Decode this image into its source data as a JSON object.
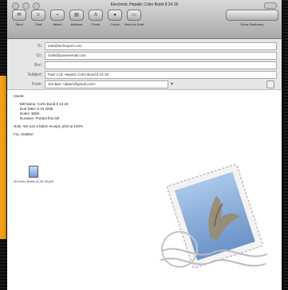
{
  "window": {
    "title": "Electronic Hepatic Cohn Bund 8 24 26"
  },
  "toolbar": {
    "buttons": [
      {
        "label": "Send",
        "icon": "send-icon"
      },
      {
        "label": "Chat",
        "icon": "chat-icon"
      },
      {
        "label": "Attach",
        "icon": "paperclip-icon"
      },
      {
        "label": "Address",
        "icon": "address-book-icon"
      },
      {
        "label": "Fonts",
        "icon": "fonts-icon"
      },
      {
        "label": "Colors",
        "icon": "colors-icon"
      },
      {
        "label": "Save As Draft",
        "icon": "draft-icon"
      }
    ],
    "stationery_label": "Show Stationery"
  },
  "headers": {
    "to_label": "To:",
    "to_value": "sdw@techreport.com",
    "cc_label": "Cc:",
    "cc_value": "cfolla@poweremail.com",
    "bcc_label": "Bcc:",
    "bcc_value": "",
    "subject_label": "Subject:",
    "subject_value": "Fwd: Lcd: Hepatic Cohn Bund 8 24 26",
    "from_label": "From:",
    "from_value": "Jen Barr <ejbarr@gmail.com>"
  },
  "body": {
    "greeting": "Sweet:",
    "details": [
      "Bill Name: Cohn Bund 8 24 26",
      "Due Date: 8 24 2008",
      "Notes: $450",
      "Duration: Printed this bill"
    ],
    "note": "Note: We use a fabric receipt; print at 100%",
    "signoff": "Fry: Heather"
  },
  "attachment": {
    "name": "3CCohn_Bund_8_24 26.pdf"
  },
  "colors": {
    "accent_strip": "#f5a316"
  }
}
